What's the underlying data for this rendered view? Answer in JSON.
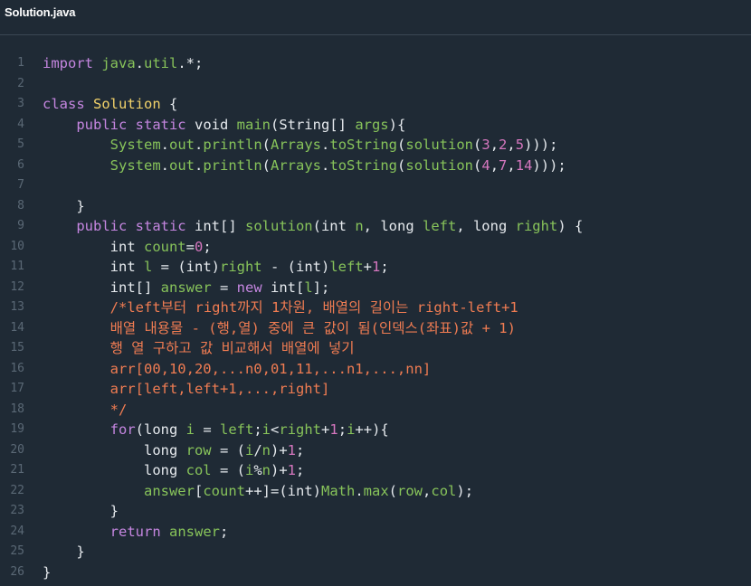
{
  "window": {
    "title": "Solution.java"
  },
  "colors": {
    "background": "#1f2a35",
    "line_number": "#5a6875",
    "plain": "#e6eaee",
    "keyword": "#c586e0",
    "class_name": "#f3d36a",
    "identifier": "#87c35a",
    "number": "#d677bf",
    "comment": "#f07c52"
  },
  "code_lines": [
    {
      "num": "1",
      "tokens": [
        [
          "kw",
          "import"
        ],
        [
          "pl",
          " "
        ],
        [
          "fn",
          "java"
        ],
        [
          "pl",
          "."
        ],
        [
          "fn",
          "util"
        ],
        [
          "pl",
          ".*;"
        ]
      ]
    },
    {
      "num": "2",
      "tokens": []
    },
    {
      "num": "3",
      "tokens": [
        [
          "kw",
          "class"
        ],
        [
          "pl",
          " "
        ],
        [
          "cls",
          "Solution"
        ],
        [
          "pl",
          " {"
        ]
      ]
    },
    {
      "num": "4",
      "tokens": [
        [
          "pl",
          "    "
        ],
        [
          "kw",
          "public static"
        ],
        [
          "pl",
          " void "
        ],
        [
          "fn",
          "main"
        ],
        [
          "pl",
          "(String[] "
        ],
        [
          "fn",
          "args"
        ],
        [
          "pl",
          "){"
        ]
      ]
    },
    {
      "num": "5",
      "tokens": [
        [
          "pl",
          "        "
        ],
        [
          "fn",
          "System"
        ],
        [
          "pl",
          "."
        ],
        [
          "fn",
          "out"
        ],
        [
          "pl",
          "."
        ],
        [
          "fn",
          "println"
        ],
        [
          "pl",
          "("
        ],
        [
          "fn",
          "Arrays"
        ],
        [
          "pl",
          "."
        ],
        [
          "fn",
          "toString"
        ],
        [
          "pl",
          "("
        ],
        [
          "fn",
          "solution"
        ],
        [
          "pl",
          "("
        ],
        [
          "num",
          "3"
        ],
        [
          "pl",
          ","
        ],
        [
          "num",
          "2"
        ],
        [
          "pl",
          ","
        ],
        [
          "num",
          "5"
        ],
        [
          "pl",
          ")));"
        ]
      ]
    },
    {
      "num": "6",
      "tokens": [
        [
          "pl",
          "        "
        ],
        [
          "fn",
          "System"
        ],
        [
          "pl",
          "."
        ],
        [
          "fn",
          "out"
        ],
        [
          "pl",
          "."
        ],
        [
          "fn",
          "println"
        ],
        [
          "pl",
          "("
        ],
        [
          "fn",
          "Arrays"
        ],
        [
          "pl",
          "."
        ],
        [
          "fn",
          "toString"
        ],
        [
          "pl",
          "("
        ],
        [
          "fn",
          "solution"
        ],
        [
          "pl",
          "("
        ],
        [
          "num",
          "4"
        ],
        [
          "pl",
          ","
        ],
        [
          "num",
          "7"
        ],
        [
          "pl",
          ","
        ],
        [
          "num",
          "14"
        ],
        [
          "pl",
          ")));"
        ]
      ]
    },
    {
      "num": "7",
      "tokens": []
    },
    {
      "num": "8",
      "tokens": [
        [
          "pl",
          "    }"
        ]
      ]
    },
    {
      "num": "9",
      "tokens": [
        [
          "pl",
          "    "
        ],
        [
          "kw",
          "public static"
        ],
        [
          "pl",
          " int[] "
        ],
        [
          "fn",
          "solution"
        ],
        [
          "pl",
          "(int "
        ],
        [
          "fn",
          "n"
        ],
        [
          "pl",
          ", long "
        ],
        [
          "fn",
          "left"
        ],
        [
          "pl",
          ", long "
        ],
        [
          "fn",
          "right"
        ],
        [
          "pl",
          ") {"
        ]
      ]
    },
    {
      "num": "10",
      "tokens": [
        [
          "pl",
          "        int "
        ],
        [
          "fn",
          "count"
        ],
        [
          "pl",
          "="
        ],
        [
          "num",
          "0"
        ],
        [
          "pl",
          ";"
        ]
      ]
    },
    {
      "num": "11",
      "tokens": [
        [
          "pl",
          "        int "
        ],
        [
          "fn",
          "l"
        ],
        [
          "pl",
          " = (int)"
        ],
        [
          "fn",
          "right"
        ],
        [
          "pl",
          " - (int)"
        ],
        [
          "fn",
          "left"
        ],
        [
          "pl",
          "+"
        ],
        [
          "num",
          "1"
        ],
        [
          "pl",
          ";"
        ]
      ]
    },
    {
      "num": "12",
      "tokens": [
        [
          "pl",
          "        int[] "
        ],
        [
          "fn",
          "answer"
        ],
        [
          "pl",
          " = "
        ],
        [
          "kw",
          "new"
        ],
        [
          "pl",
          " int["
        ],
        [
          "fn",
          "l"
        ],
        [
          "pl",
          "];"
        ]
      ]
    },
    {
      "num": "13",
      "tokens": [
        [
          "pl",
          "        "
        ],
        [
          "com",
          "/*left부터 right까지 1차원, 배열의 길이는 right-left+1"
        ]
      ]
    },
    {
      "num": "14",
      "tokens": [
        [
          "pl",
          "        "
        ],
        [
          "com",
          "배열 내용물 - (행,열) 중에 큰 값이 됨(인덱스(좌표)값 + 1)"
        ]
      ]
    },
    {
      "num": "15",
      "tokens": [
        [
          "pl",
          "        "
        ],
        [
          "com",
          "행 열 구하고 값 비교해서 배열에 넣기"
        ]
      ]
    },
    {
      "num": "16",
      "tokens": [
        [
          "pl",
          "        "
        ],
        [
          "com",
          "arr[00,10,20,...n0,01,11,...n1,...,nn]"
        ]
      ]
    },
    {
      "num": "17",
      "tokens": [
        [
          "pl",
          "        "
        ],
        [
          "com",
          "arr[left,left+1,...,right]"
        ]
      ]
    },
    {
      "num": "18",
      "tokens": [
        [
          "pl",
          "        "
        ],
        [
          "com",
          "*/"
        ]
      ]
    },
    {
      "num": "19",
      "tokens": [
        [
          "pl",
          "        "
        ],
        [
          "kw",
          "for"
        ],
        [
          "pl",
          "(long "
        ],
        [
          "fn",
          "i"
        ],
        [
          "pl",
          " = "
        ],
        [
          "fn",
          "left"
        ],
        [
          "pl",
          ";"
        ],
        [
          "fn",
          "i"
        ],
        [
          "pl",
          "<"
        ],
        [
          "fn",
          "right"
        ],
        [
          "pl",
          "+"
        ],
        [
          "num",
          "1"
        ],
        [
          "pl",
          ";"
        ],
        [
          "fn",
          "i"
        ],
        [
          "pl",
          "++){"
        ]
      ]
    },
    {
      "num": "20",
      "tokens": [
        [
          "pl",
          "            long "
        ],
        [
          "fn",
          "row"
        ],
        [
          "pl",
          " = ("
        ],
        [
          "fn",
          "i"
        ],
        [
          "pl",
          "/"
        ],
        [
          "fn",
          "n"
        ],
        [
          "pl",
          ")+"
        ],
        [
          "num",
          "1"
        ],
        [
          "pl",
          ";"
        ]
      ]
    },
    {
      "num": "21",
      "tokens": [
        [
          "pl",
          "            long "
        ],
        [
          "fn",
          "col"
        ],
        [
          "pl",
          " = ("
        ],
        [
          "fn",
          "i"
        ],
        [
          "pl",
          "%"
        ],
        [
          "fn",
          "n"
        ],
        [
          "pl",
          ")+"
        ],
        [
          "num",
          "1"
        ],
        [
          "pl",
          ";"
        ]
      ]
    },
    {
      "num": "22",
      "tokens": [
        [
          "pl",
          "            "
        ],
        [
          "fn",
          "answer"
        ],
        [
          "pl",
          "["
        ],
        [
          "fn",
          "count"
        ],
        [
          "pl",
          "++]=(int)"
        ],
        [
          "fn",
          "Math"
        ],
        [
          "pl",
          "."
        ],
        [
          "fn",
          "max"
        ],
        [
          "pl",
          "("
        ],
        [
          "fn",
          "row"
        ],
        [
          "pl",
          ","
        ],
        [
          "fn",
          "col"
        ],
        [
          "pl",
          ");"
        ]
      ]
    },
    {
      "num": "23",
      "tokens": [
        [
          "pl",
          "        }"
        ]
      ]
    },
    {
      "num": "24",
      "tokens": [
        [
          "pl",
          "        "
        ],
        [
          "kw",
          "return"
        ],
        [
          "pl",
          " "
        ],
        [
          "fn",
          "answer"
        ],
        [
          "pl",
          ";"
        ]
      ]
    },
    {
      "num": "25",
      "tokens": [
        [
          "pl",
          "    }"
        ]
      ]
    },
    {
      "num": "26",
      "tokens": [
        [
          "pl",
          "}"
        ]
      ]
    }
  ]
}
